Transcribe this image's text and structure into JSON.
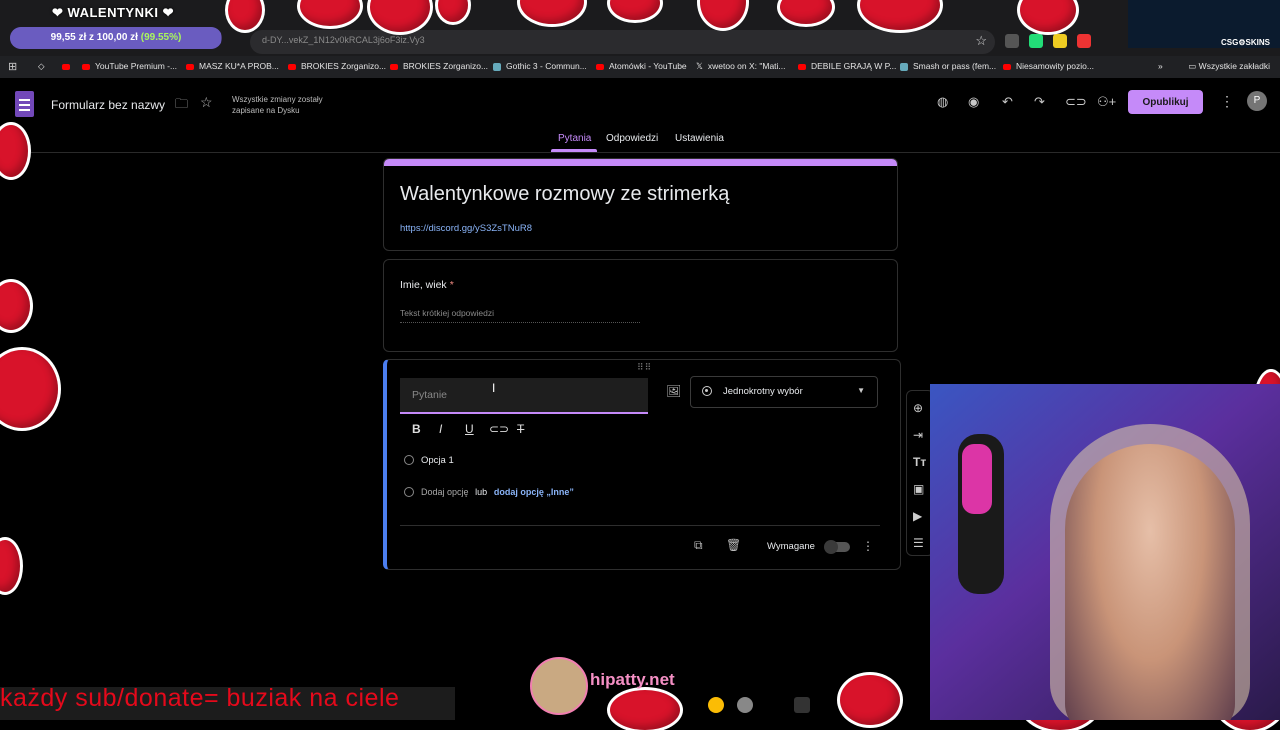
{
  "browser": {
    "url": "d-DY...vekZ_1N12v0kRCAL3j6oF3iz.Vy3",
    "bookmarks": [
      {
        "label": "YouTube Premium -...",
        "icon": "youtube-icon"
      },
      {
        "label": "MASZ KU*A PROB...",
        "icon": "youtube-icon"
      },
      {
        "label": "BROKIES Zorganizo...",
        "icon": "youtube-icon"
      },
      {
        "label": "BROKIES Zorganizo...",
        "icon": "youtube-icon"
      },
      {
        "label": "Gothic 3 - Commun...",
        "icon": "page-icon"
      },
      {
        "label": "Atomówki - YouTube",
        "icon": "youtube-icon"
      },
      {
        "label": "xwetoo on X: \"Mati...",
        "icon": "x-icon"
      },
      {
        "label": "DEBILE GRAJĄ W P...",
        "icon": "youtube-icon"
      },
      {
        "label": "Smash or pass (fem...",
        "icon": "page-icon"
      },
      {
        "label": "Niesamowity pozio...",
        "icon": "youtube-icon"
      }
    ],
    "all_bookmarks": "Wszystkie zakładki"
  },
  "forms_header": {
    "title": "Formularz bez nazwy",
    "saved_status": "Wszystkie zmiany zostały zapisane na Dysku",
    "publish_label": "Opublikuj",
    "avatar_letter": "P",
    "tabs": [
      "Pytania",
      "Odpowiedzi",
      "Ustawienia"
    ],
    "active_tab": "Pytania",
    "accent": "#c58af9"
  },
  "form": {
    "title": "Walentynkowe rozmowy ze strimerką",
    "description": "https://discord.gg/yS3ZsTNuR8",
    "question1": {
      "label": "Imie, wiek",
      "required_marker": "*",
      "placeholder": "Tekst krótkiej odpowiedzi"
    },
    "question2": {
      "placeholder": "Pytanie",
      "type": "Jednokrotny wybór",
      "option1": "Opcja 1",
      "add_option": "Dodaj opcję",
      "or": "lub",
      "add_other": "dodaj opcję „Inne”",
      "required_label": "Wymagane",
      "required": false
    }
  },
  "stream": {
    "goal_title": "WALENTYNKI",
    "goal_amount": "99,55 zł z 100,00 zł",
    "goal_percent": "(99.55%)",
    "goal_fraction": 0.9955,
    "sponsor": "CSG⚙SKINS",
    "banner": "każdy sub/donate= buziak na ciele",
    "site": "hipatty.net",
    "heart_color": "#d8132a"
  }
}
